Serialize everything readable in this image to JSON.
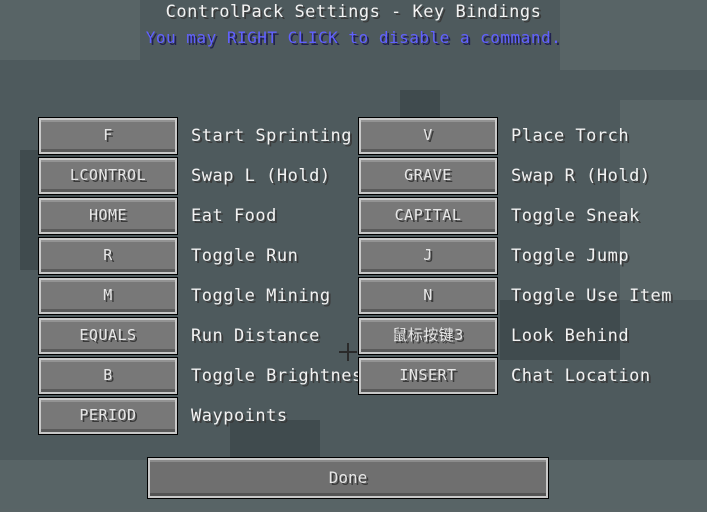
{
  "screen": {
    "title": "ControlPack Settings - Key Bindings",
    "subtitle": "You may RIGHT CLICK to disable a command.",
    "subtitle_color": "#6060ff"
  },
  "left_bindings": [
    {
      "key": "F",
      "action": "Start Sprinting"
    },
    {
      "key": "LCONTROL",
      "action": "Swap L (Hold)"
    },
    {
      "key": "HOME",
      "action": "Eat Food"
    },
    {
      "key": "R",
      "action": "Toggle Run"
    },
    {
      "key": "M",
      "action": "Toggle Mining"
    },
    {
      "key": "EQUALS",
      "action": "Run Distance"
    },
    {
      "key": "B",
      "action": "Toggle Brightness"
    },
    {
      "key": "PERIOD",
      "action": "Waypoints"
    }
  ],
  "right_bindings": [
    {
      "key": "V",
      "action": "Place Torch"
    },
    {
      "key": "GRAVE",
      "action": "Swap R (Hold)"
    },
    {
      "key": "CAPITAL",
      "action": "Toggle Sneak"
    },
    {
      "key": "J",
      "action": "Toggle Jump"
    },
    {
      "key": "N",
      "action": "Toggle Use Item"
    },
    {
      "key": "鼠标按键3",
      "action": "Look Behind"
    },
    {
      "key": "INSERT",
      "action": "Chat Location"
    }
  ],
  "done_button": {
    "label": "Done"
  }
}
